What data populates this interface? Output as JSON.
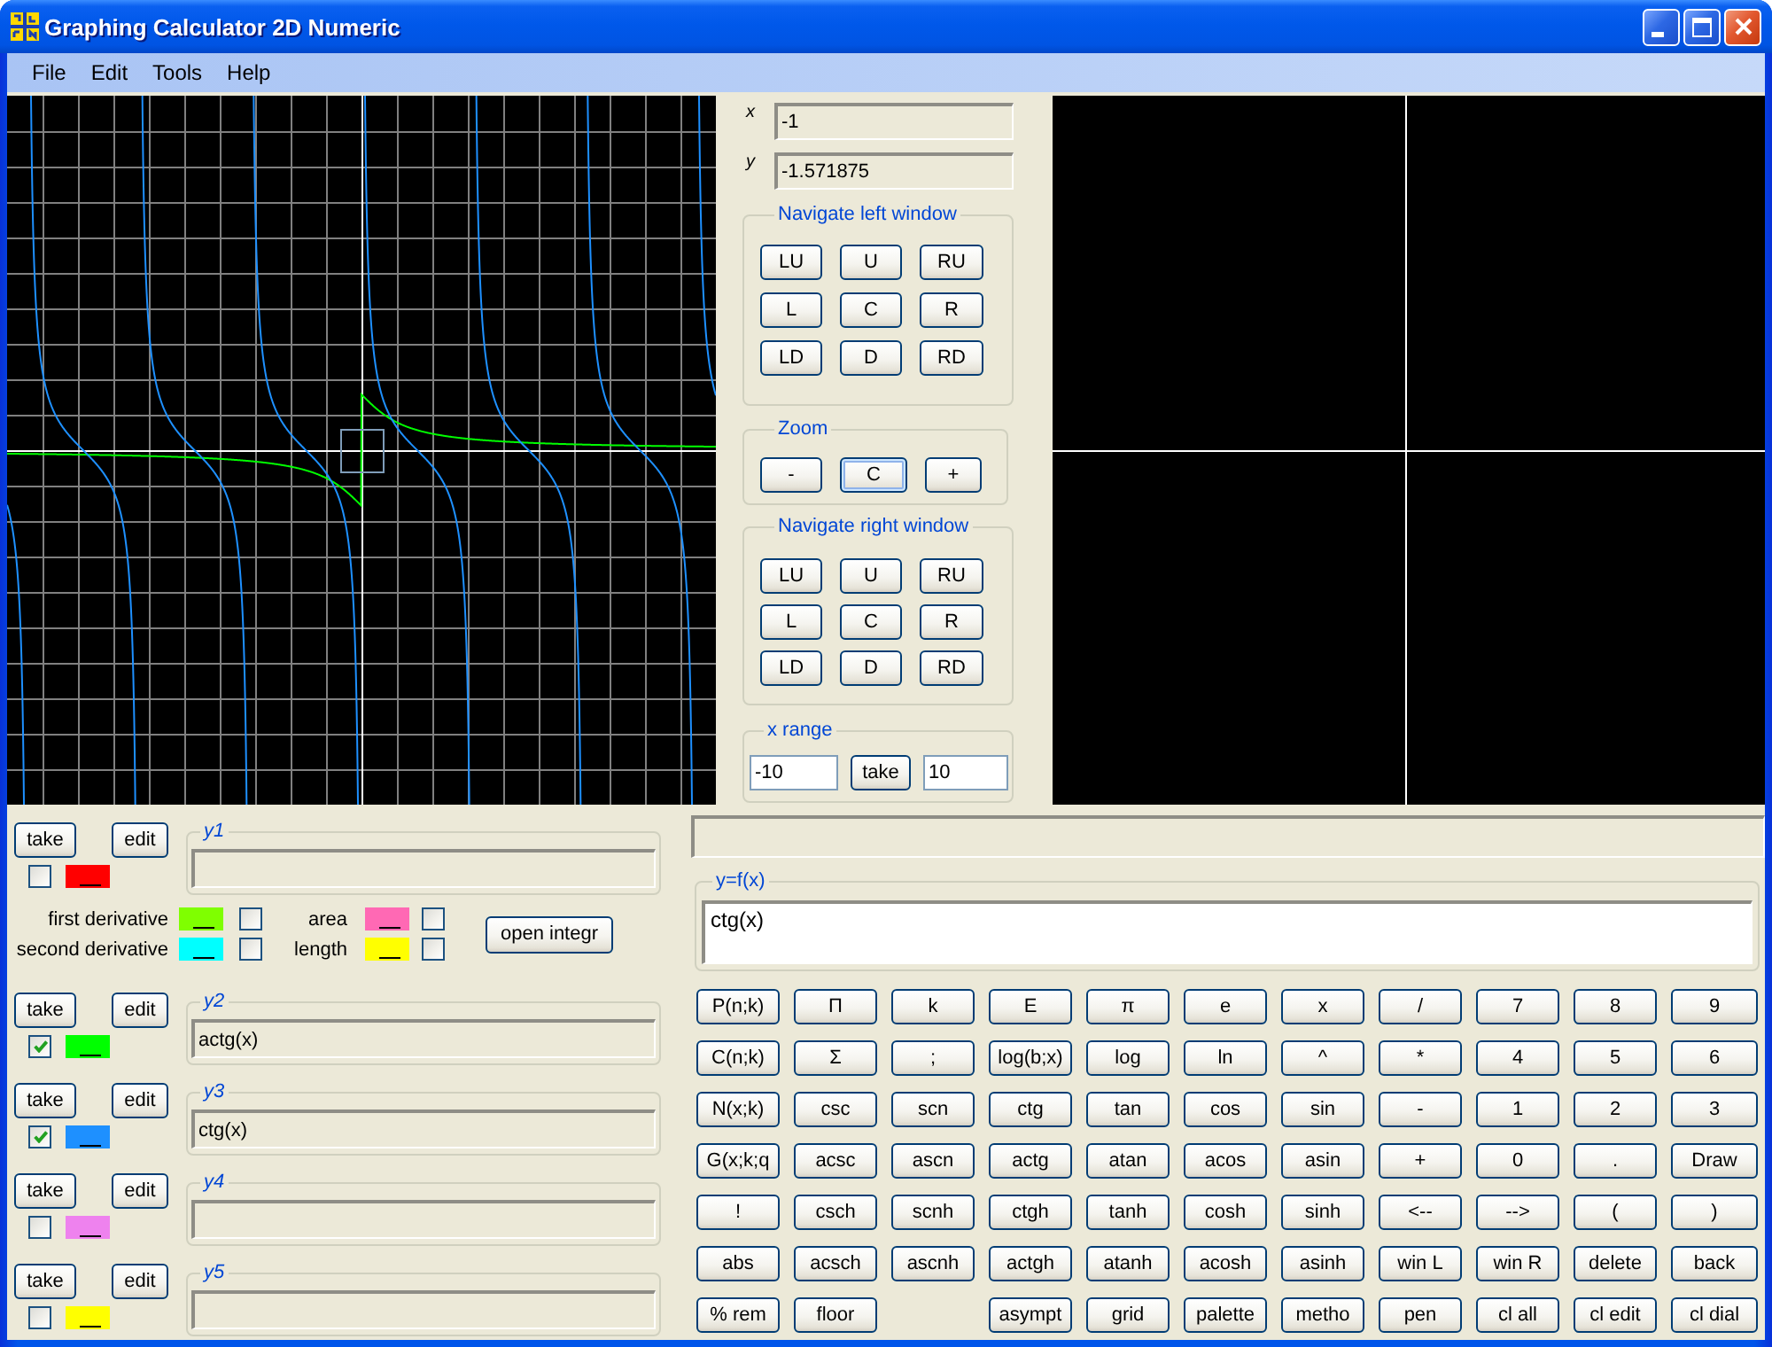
{
  "window": {
    "title": "Graphing Calculator 2D Numeric"
  },
  "menu": [
    "File",
    "Edit",
    "Tools",
    "Help"
  ],
  "pointer": [
    {
      "label": "x",
      "value": "-1"
    },
    {
      "label": "y",
      "value": "-1.571875"
    }
  ],
  "navigate_left": {
    "title": "Navigate left window",
    "buttons": [
      "LU",
      "U",
      "RU",
      "L",
      "C",
      "R",
      "LD",
      "D",
      "RD"
    ]
  },
  "zoom": {
    "title": "Zoom",
    "buttons": [
      {
        "label": "-",
        "focused": false
      },
      {
        "label": "C",
        "focused": true
      },
      {
        "label": "+",
        "focused": false
      }
    ]
  },
  "navigate_right": {
    "title": "Navigate right window",
    "buttons": [
      "LU",
      "U",
      "RU",
      "L",
      "C",
      "R",
      "LD",
      "D",
      "RD"
    ]
  },
  "x_range": {
    "title": "x range",
    "from": "-10",
    "button": "take",
    "to": "10"
  },
  "functions": [
    {
      "name": "y1",
      "buttons": [
        "take",
        "edit"
      ],
      "checked": false,
      "color": "#ff0000"
    },
    {
      "name": "y2",
      "buttons": [
        "take",
        "edit"
      ],
      "checked": true,
      "color": "#00ff00",
      "value": "actg(x)"
    },
    {
      "name": "y3",
      "buttons": [
        "take",
        "edit"
      ],
      "checked": true,
      "color": "#1e90ff",
      "value": "ctg(x)"
    },
    {
      "name": "y4",
      "buttons": [
        "take",
        "edit"
      ],
      "checked": false,
      "color": "#ee82ee"
    },
    {
      "name": "y5",
      "buttons": [
        "take",
        "edit"
      ],
      "checked": false,
      "color": "#ffff00"
    }
  ],
  "derivatives": [
    {
      "label": "first derivative",
      "color": "#7fff00",
      "checked": false
    },
    {
      "label": "second derivative",
      "color": "#00ffff",
      "checked": false
    }
  ],
  "measures": [
    {
      "label": "area",
      "color": "#ff69b4",
      "checked": false
    },
    {
      "label": "length",
      "color": "#ffff00",
      "checked": false
    }
  ],
  "integral_button": "open integr",
  "expression": {
    "label": "y=f(x)",
    "value": "ctg(x)"
  },
  "keypad": {
    "rows": [
      [
        "P(n;k)",
        "Π",
        "k",
        "E",
        "π",
        "e",
        "x",
        "/",
        "7",
        "8",
        "9"
      ],
      [
        "C(n;k)",
        "Σ",
        ";",
        "log(b;x)",
        "log",
        "ln",
        "^",
        "*",
        "4",
        "5",
        "6"
      ],
      [
        "N(x;k)",
        "csc",
        "scn",
        "ctg",
        "tan",
        "cos",
        "sin",
        "-",
        "1",
        "2",
        "3"
      ],
      [
        "G(x;k;q",
        "acsc",
        "ascn",
        "actg",
        "atan",
        "acos",
        "asin",
        "+",
        "0",
        ".",
        "Draw"
      ],
      [
        "!",
        "csch",
        "scnh",
        "ctgh",
        "tanh",
        "cosh",
        "sinh",
        "<--",
        "-->",
        "(",
        ")"
      ],
      [
        "abs",
        "acsch",
        "ascnh",
        "actgh",
        "atanh",
        "acosh",
        "asinh",
        "win L",
        "win R",
        "delete",
        "back"
      ]
    ],
    "last_row": {
      "left": [
        "% rem",
        "floor"
      ],
      "right": [
        "asympt",
        "grid",
        "palette",
        "metho",
        "pen",
        "cl all",
        "cl edit",
        "cl dial"
      ]
    }
  }
}
